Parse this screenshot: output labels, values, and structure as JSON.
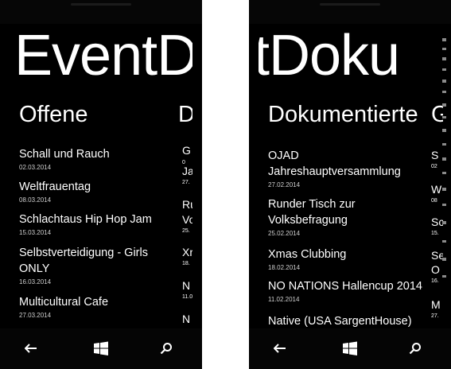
{
  "app_title": "EventDoku",
  "left": {
    "title_visible": "EventD",
    "section": "Offene",
    "next_section_fragment": "D",
    "items": [
      {
        "title": "Schall und Rauch",
        "date": "02.03.2014"
      },
      {
        "title": "Weltfrauentag",
        "date": "08.03.2014"
      },
      {
        "title": "Schlachtaus Hip Hop Jam",
        "date": "15.03.2014"
      },
      {
        "title": "Selbstverteidigung - Girls ONLY",
        "date": "16.03.2014"
      },
      {
        "title": "Multicultural Cafe",
        "date": "27.03.2014"
      }
    ],
    "peek_items": [
      {
        "title": "G",
        "date": "0"
      },
      {
        "title": "Ja",
        "date": "27."
      },
      {
        "title": "Ru",
        "date": ""
      },
      {
        "title": "Vo",
        "date": "25."
      },
      {
        "title": "Xr",
        "date": "18."
      },
      {
        "title": "N",
        "date": "11.0"
      },
      {
        "title": "N",
        "date": ""
      }
    ]
  },
  "right": {
    "title_visible": "tDoku",
    "section": "Dokumentierte",
    "next_section_fragment": "G",
    "items": [
      {
        "title": "OJAD Jahreshauptversammlung",
        "date": "27.02.2014"
      },
      {
        "title": "Runder Tisch zur Volksbefragung",
        "date": "25.02.2014"
      },
      {
        "title": "Xmas Clubbing",
        "date": "18.02.2014"
      },
      {
        "title": "NO NATIONS Hallencup 2014",
        "date": "11.02.2014"
      },
      {
        "title": "Native (USA SargentHouse)",
        "date": ""
      }
    ],
    "peek_items": [
      {
        "title": "S",
        "date": "02"
      },
      {
        "title": "W",
        "date": "08"
      },
      {
        "title": "Sc",
        "date": "15."
      },
      {
        "title": "Se",
        "date": ""
      },
      {
        "title": "O",
        "date": "16."
      },
      {
        "title": "M",
        "date": "27."
      }
    ]
  },
  "appbar": {
    "back_icon": "back-arrow-icon",
    "start_icon": "windows-logo-icon",
    "search_icon": "search-icon"
  },
  "colors": {
    "background": "#000000",
    "text": "#ffffff",
    "subtext": "#cfcfcf"
  }
}
